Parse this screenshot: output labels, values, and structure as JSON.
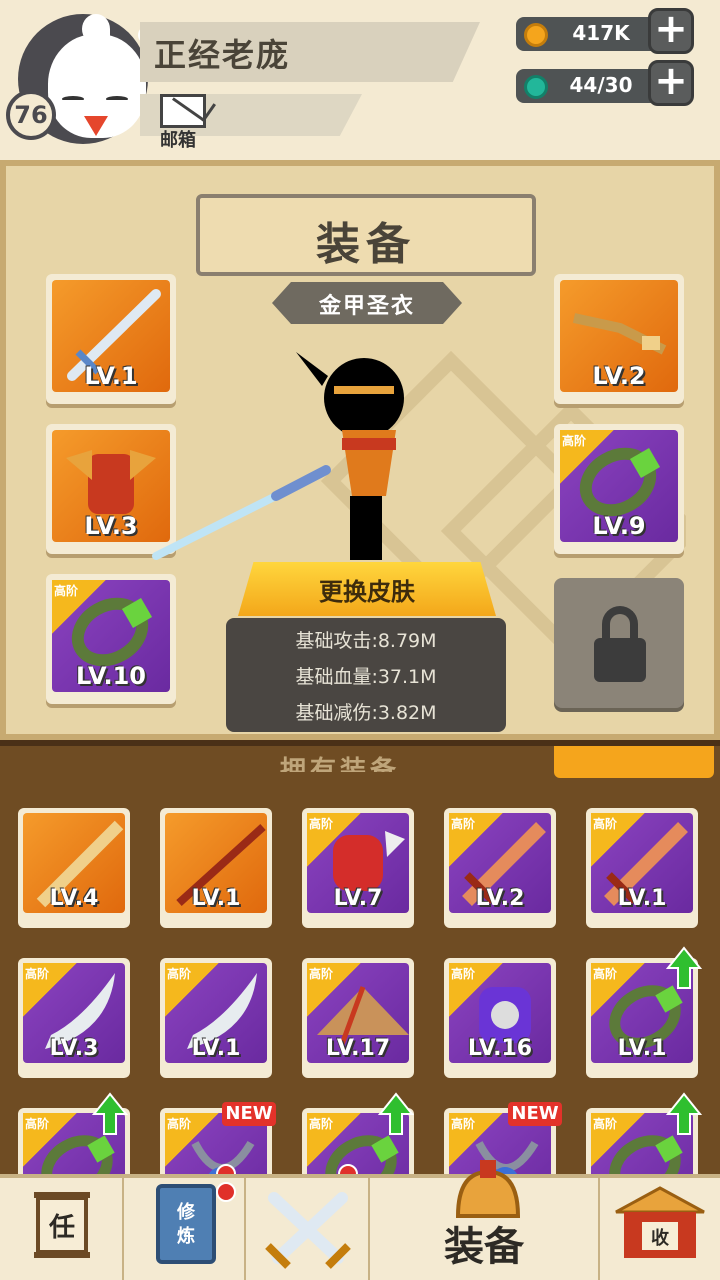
{
  "header": {
    "player_name": "正经老庞",
    "level": "76",
    "mail_label": "邮箱",
    "gold_value": "417K",
    "energy_value": "44/30",
    "gold_color": "#f5a51c",
    "energy_color": "#22b79a"
  },
  "equipment": {
    "title": "装备",
    "subtitle": "金甲圣衣",
    "skin_button": "更换皮肤",
    "stats": {
      "attack": "基础攻击:8.79M",
      "health": "基础血量:37.1M",
      "damage_reduction": "基础减伤:3.82M"
    },
    "slots": [
      {
        "level": "LV.1",
        "rarity": "orange",
        "item": "sword-icon",
        "tier": ""
      },
      {
        "level": "LV.2",
        "rarity": "orange",
        "item": "necklace-icon",
        "tier": ""
      },
      {
        "level": "LV.3",
        "rarity": "orange",
        "item": "armor-icon",
        "tier": ""
      },
      {
        "level": "LV.9",
        "rarity": "purple",
        "item": "ring-icon",
        "tier": "高阶"
      },
      {
        "level": "LV.10",
        "rarity": "purple",
        "item": "ring-icon",
        "tier": "高阶"
      }
    ]
  },
  "inventory": {
    "items": [
      {
        "level": "LV.4",
        "rarity": "orange",
        "item": "blade-icon",
        "tier": ""
      },
      {
        "level": "LV.1",
        "rarity": "orange",
        "item": "staff-icon",
        "tier": ""
      },
      {
        "level": "LV.7",
        "rarity": "purple",
        "item": "gauntlet-icon",
        "tier": "高阶"
      },
      {
        "level": "LV.2",
        "rarity": "purple",
        "item": "sword-icon",
        "tier": "高阶"
      },
      {
        "level": "LV.1",
        "rarity": "purple",
        "item": "sword-icon",
        "tier": "高阶"
      },
      {
        "level": "LV.3",
        "rarity": "purple",
        "item": "scimitar-icon",
        "tier": "高阶"
      },
      {
        "level": "LV.1",
        "rarity": "purple",
        "item": "scimitar-icon",
        "tier": "高阶"
      },
      {
        "level": "LV.17",
        "rarity": "purple",
        "item": "hat-icon",
        "tier": "高阶"
      },
      {
        "level": "LV.16",
        "rarity": "purple",
        "item": "armor-icon",
        "tier": "高阶"
      },
      {
        "level": "LV.1",
        "rarity": "purple",
        "item": "ring-icon",
        "tier": "高阶"
      },
      {
        "level": "",
        "rarity": "purple",
        "item": "ring-icon",
        "tier": "高阶"
      },
      {
        "level": "",
        "rarity": "purple",
        "item": "necklace-icon",
        "tier": "高阶"
      },
      {
        "level": "",
        "rarity": "purple",
        "item": "ring-icon",
        "tier": "高阶"
      },
      {
        "level": "",
        "rarity": "purple",
        "item": "necklace-icon",
        "tier": "高阶"
      },
      {
        "level": "",
        "rarity": "purple",
        "item": "ring-icon",
        "tier": "高阶"
      }
    ],
    "new_badge": "NEW"
  },
  "nav": {
    "task_glyph": "任",
    "cultivate_glyph": "修炼",
    "equipment_label": "装备",
    "shop_glyph": "收"
  }
}
